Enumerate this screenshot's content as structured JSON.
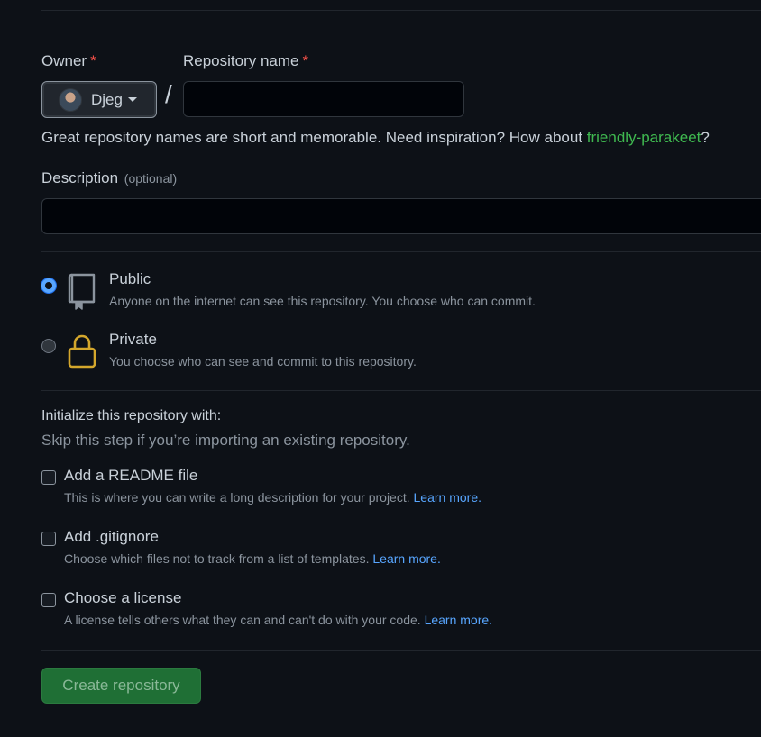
{
  "owner": {
    "label": "Owner",
    "required_mark": "*",
    "selected": "Djeg"
  },
  "repo_name": {
    "label": "Repository name",
    "required_mark": "*",
    "value": "",
    "separator": "/"
  },
  "hint": {
    "prefix": "Great repository names are short and memorable. Need inspiration? How about ",
    "suggestion": "friendly-parakeet",
    "suffix": "?"
  },
  "description": {
    "label": "Description",
    "optional": "(optional)",
    "value": ""
  },
  "visibility": {
    "selected": "public",
    "options": [
      {
        "id": "public",
        "title": "Public",
        "desc": "Anyone on the internet can see this repository. You choose who can commit.",
        "icon": "repo-icon"
      },
      {
        "id": "private",
        "title": "Private",
        "desc": "You choose who can see and commit to this repository.",
        "icon": "lock-icon"
      }
    ]
  },
  "init": {
    "title": "Initialize this repository with:",
    "subtitle": "Skip this step if you’re importing an existing repository.",
    "items": [
      {
        "title": "Add a README file",
        "desc": "This is where you can write a long description for your project.",
        "link": "Learn more.",
        "checked": false
      },
      {
        "title": "Add .gitignore",
        "desc": "Choose which files not to track from a list of templates.",
        "link": "Learn more.",
        "checked": false
      },
      {
        "title": "Choose a license",
        "desc": "A license tells others what they can and can't do with your code.",
        "link": "Learn more.",
        "checked": false
      }
    ]
  },
  "submit": {
    "label": "Create repository"
  },
  "colors": {
    "background": "#0d1117",
    "accent_link": "#58a6ff",
    "suggestion": "#3fb950",
    "required": "#f85149",
    "lock_icon": "#d4a72c",
    "button": "#1f6f35"
  }
}
